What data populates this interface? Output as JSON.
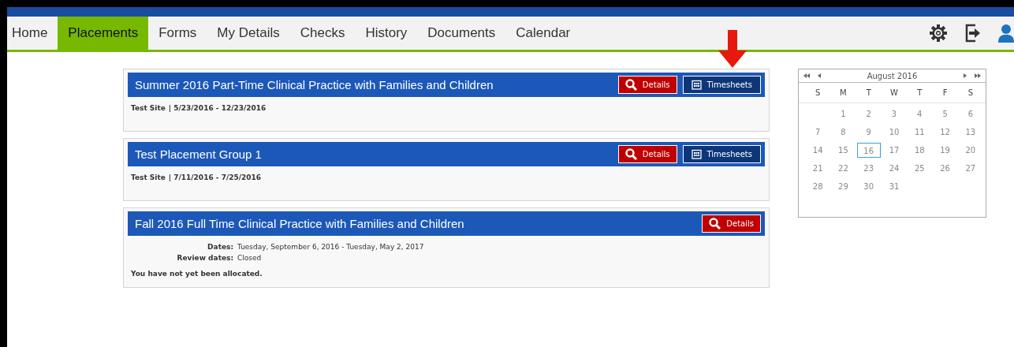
{
  "nav": {
    "items": [
      {
        "label": "Home",
        "selected": false
      },
      {
        "label": "Placements",
        "selected": true
      },
      {
        "label": "Forms",
        "selected": false
      },
      {
        "label": "My Details",
        "selected": false
      },
      {
        "label": "Checks",
        "selected": false
      },
      {
        "label": "History",
        "selected": false
      },
      {
        "label": "Documents",
        "selected": false
      },
      {
        "label": "Calendar",
        "selected": false
      }
    ]
  },
  "placements": [
    {
      "title": "Summer 2016 Part-Time Clinical Practice with Families and Children",
      "buttons": [
        {
          "kind": "details",
          "label": "Details"
        },
        {
          "kind": "timesheets",
          "label": "Timesheets"
        }
      ],
      "site": "Test Site",
      "range": "| 5/23/2016 - 12/23/2016",
      "annotated": true
    },
    {
      "title": "Test Placement Group 1",
      "buttons": [
        {
          "kind": "details",
          "label": "Details"
        },
        {
          "kind": "timesheets",
          "label": "Timesheets"
        }
      ],
      "site": "Test Site",
      "range": "| 7/11/2016 - 7/25/2016"
    },
    {
      "title": "Fall 2016 Full Time Clinical Practice with Families and Children",
      "buttons": [
        {
          "kind": "details",
          "label": "Details"
        }
      ],
      "fields": [
        {
          "label": "Dates:",
          "value": "Tuesday, September 6, 2016 - Tuesday, May 2, 2017"
        },
        {
          "label": "Review dates:",
          "value": "Closed"
        }
      ],
      "note": "You have not yet been allocated."
    }
  ],
  "calendar": {
    "month": "August 2016",
    "weekdays": [
      "S",
      "M",
      "T",
      "W",
      "T",
      "F",
      "S"
    ],
    "weeks": [
      [
        {
          "day": "1",
          "selected": false
        },
        {
          "day": "2",
          "selected": false
        },
        {
          "day": "3",
          "selected": false
        },
        {
          "day": "4",
          "selected": false
        },
        {
          "day": "5",
          "selected": false
        },
        {
          "day": "6",
          "selected": false
        }
      ],
      [
        {
          "day": "7",
          "selected": false
        },
        {
          "day": "8",
          "selected": false
        },
        {
          "day": "9",
          "selected": false
        },
        {
          "day": "10",
          "selected": false
        },
        {
          "day": "11",
          "selected": false
        },
        {
          "day": "12",
          "selected": false
        },
        {
          "day": "13",
          "selected": false
        }
      ],
      [
        {
          "day": "14",
          "selected": false
        },
        {
          "day": "15",
          "selected": false
        },
        {
          "day": "16",
          "selected": true
        },
        {
          "day": "17",
          "selected": false
        },
        {
          "day": "18",
          "selected": false
        },
        {
          "day": "19",
          "selected": false
        },
        {
          "day": "20",
          "selected": false
        }
      ],
      [
        {
          "day": "21",
          "selected": false
        },
        {
          "day": "22",
          "selected": false
        },
        {
          "day": "23",
          "selected": false
        },
        {
          "day": "24",
          "selected": false
        },
        {
          "day": "25",
          "selected": false
        },
        {
          "day": "26",
          "selected": false
        },
        {
          "day": "27",
          "selected": false
        }
      ],
      [
        {
          "day": "28",
          "selected": false
        },
        {
          "day": "29",
          "selected": false
        },
        {
          "day": "30",
          "selected": false
        },
        {
          "day": "31",
          "selected": false
        }
      ]
    ]
  }
}
